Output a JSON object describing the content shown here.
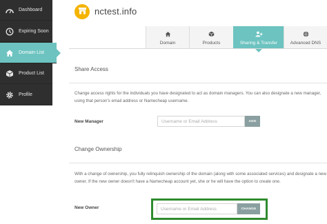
{
  "sidebar": {
    "items": [
      {
        "label": "Dashboard",
        "icon": "dashboard-icon",
        "active": false
      },
      {
        "label": "Expiring Soon",
        "icon": "clock-icon",
        "active": false
      },
      {
        "label": "Domain List",
        "icon": "home-icon",
        "active": true
      },
      {
        "label": "Product List",
        "icon": "box-icon",
        "active": false
      },
      {
        "label": "Profile",
        "icon": "gear-icon",
        "active": false
      }
    ]
  },
  "header": {
    "domain_name": "nctest.info",
    "logo_icon": "store-icon",
    "logo_color": "#f4b400"
  },
  "tabs": [
    {
      "label": "Domain",
      "icon": "home-icon",
      "active": false
    },
    {
      "label": "Products",
      "icon": "box-icon",
      "active": false
    },
    {
      "label": "Sharing & Transfer",
      "icon": "user-add-icon",
      "active": true
    },
    {
      "label": "Advanced DNS",
      "icon": "globe-icon",
      "active": false
    }
  ],
  "share_access": {
    "title": "Share Access",
    "description": "Change access rights for the individuals you have designated to act as domain managers. You can also designate a new manager, using that person's email address or Namecheap username.",
    "field_label": "New Manager",
    "input_placeholder": "Username or Email Address",
    "button_label": "ADD"
  },
  "change_ownership": {
    "title": "Change Ownership",
    "description": "With a change of ownership, you fully relinquish ownership of the domain (along with some associated services) and designate a new owner. If the new owner doesn't have a Namecheap account yet, she or he will have the option to create one.",
    "field_label": "New Owner",
    "input_placeholder": "Username or Email Address",
    "button_label": "CHANGE"
  },
  "colors": {
    "accent": "#6cc3c0",
    "sidebar": "#2f2f2f",
    "button": "#8a9fa0",
    "highlight": "#2e8b2e"
  }
}
